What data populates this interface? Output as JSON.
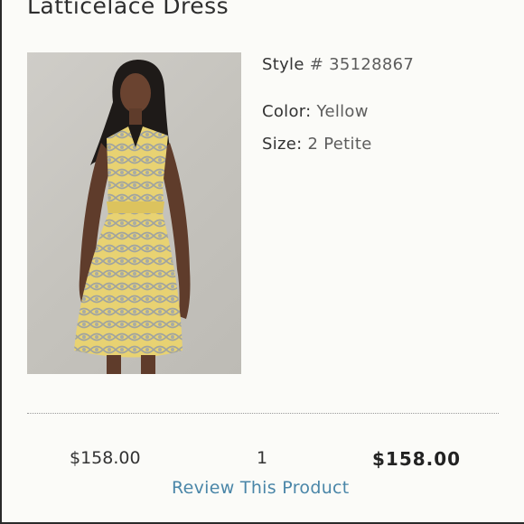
{
  "product": {
    "title": "Latticelace Dress",
    "style_label": "Style",
    "style_value": "# 35128867",
    "color_label": "Color:",
    "color_value": "Yellow",
    "size_label": "Size:",
    "size_value": "2 Petite"
  },
  "order": {
    "unit_price": "$158.00",
    "quantity": "1",
    "total_price": "$158.00"
  },
  "links": {
    "review": "Review This Product"
  },
  "colors": {
    "link": "#4a86a8",
    "dress": "#e6cf6a",
    "background": "#fbfbf8"
  }
}
